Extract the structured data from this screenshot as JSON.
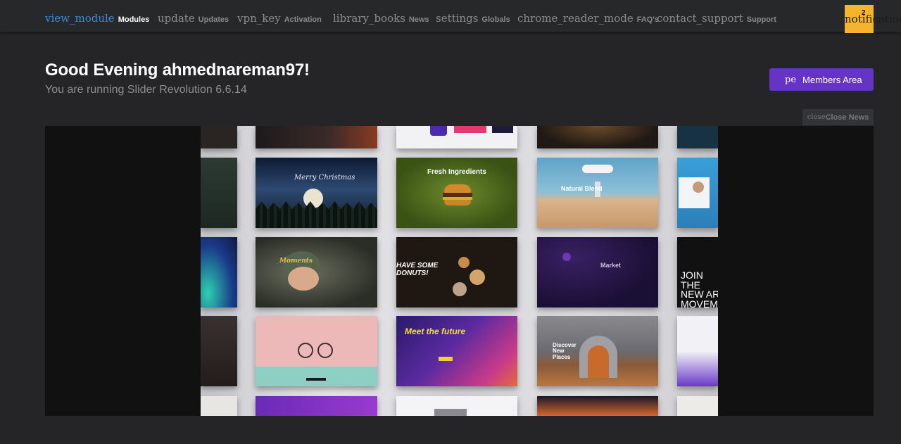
{
  "nav": {
    "items": [
      {
        "glyph": "view_module",
        "label": "Modules",
        "active": true
      },
      {
        "glyph": "update",
        "label": "Updates"
      },
      {
        "glyph": "vpn_key",
        "label": "Activation"
      },
      {
        "glyph": "library_books",
        "label": "News"
      },
      {
        "glyph": "settings",
        "label": "Globals"
      },
      {
        "glyph": "chrome_reader_mode",
        "label": "FAQ's"
      },
      {
        "glyph": "contact_support",
        "label": "Support"
      }
    ],
    "notifications": {
      "glyph": "notifications",
      "count": "2"
    }
  },
  "header": {
    "greeting": "Good Evening ahmednareman97!",
    "version": "You are running Slider Revolution 6.6.14"
  },
  "members": {
    "glyph": "pe",
    "label": "Members Area"
  },
  "close_news": {
    "glyph": "close",
    "label": "Close News"
  },
  "news": {
    "tiles": {
      "christmas": "Merry Christmas",
      "ingredients": "Fresh Ingredients",
      "natural": "Natural Blend",
      "moments": "Moments",
      "donuts": "HAVE SOME DONUTS!",
      "market": "Market",
      "join": "JOIN THE NEW AR MOVEM",
      "future": "Meet the future",
      "discover": "Discover New Places"
    }
  },
  "colors": {
    "accent": "#6533c6",
    "active_nav": "#3b8bd9",
    "notification": "#f6b42d"
  }
}
